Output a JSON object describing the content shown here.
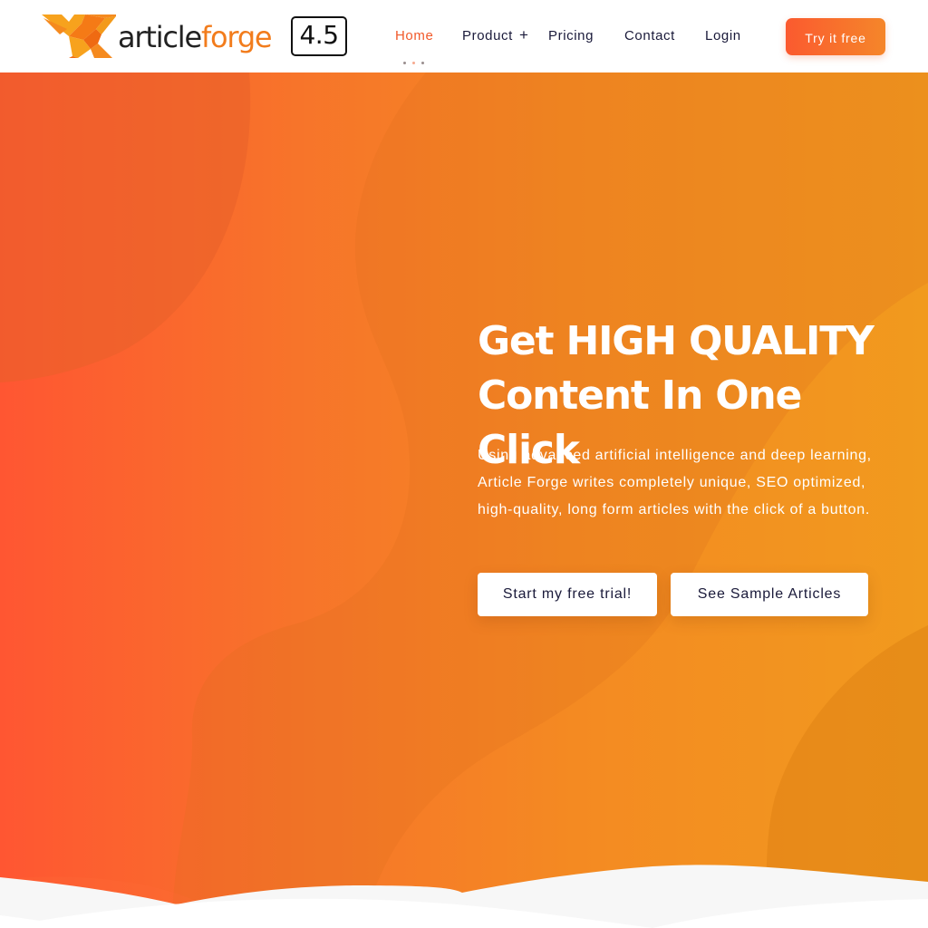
{
  "logo": {
    "word_dark": "article",
    "word_orange": "forge",
    "version": "4.5",
    "icon": "origami-fox-anvil-icon"
  },
  "nav": {
    "items": [
      {
        "label": "Home",
        "active": true
      },
      {
        "label": "Product",
        "has_submenu": true,
        "submenu_icon": "+"
      },
      {
        "label": "Pricing"
      },
      {
        "label": "Contact"
      },
      {
        "label": "Login"
      }
    ],
    "cta_label": "Try it free"
  },
  "hero": {
    "title_line1": "Get HIGH QUALITY",
    "title_line2": "Content In One Click",
    "description": "Using advanced artificial intelligence and deep learning, Article Forge writes completely unique, SEO optimized, high-quality, long form articles with the click of a button.",
    "primary_button": "Start my free trial!",
    "secondary_button": "See Sample Articles"
  },
  "colors": {
    "accent": "#f15a2b",
    "gradient_start": "#ff5632",
    "gradient_end": "#f19a1e",
    "nav_text": "#1a1a3a",
    "logo_orange": "#f27c1c"
  }
}
